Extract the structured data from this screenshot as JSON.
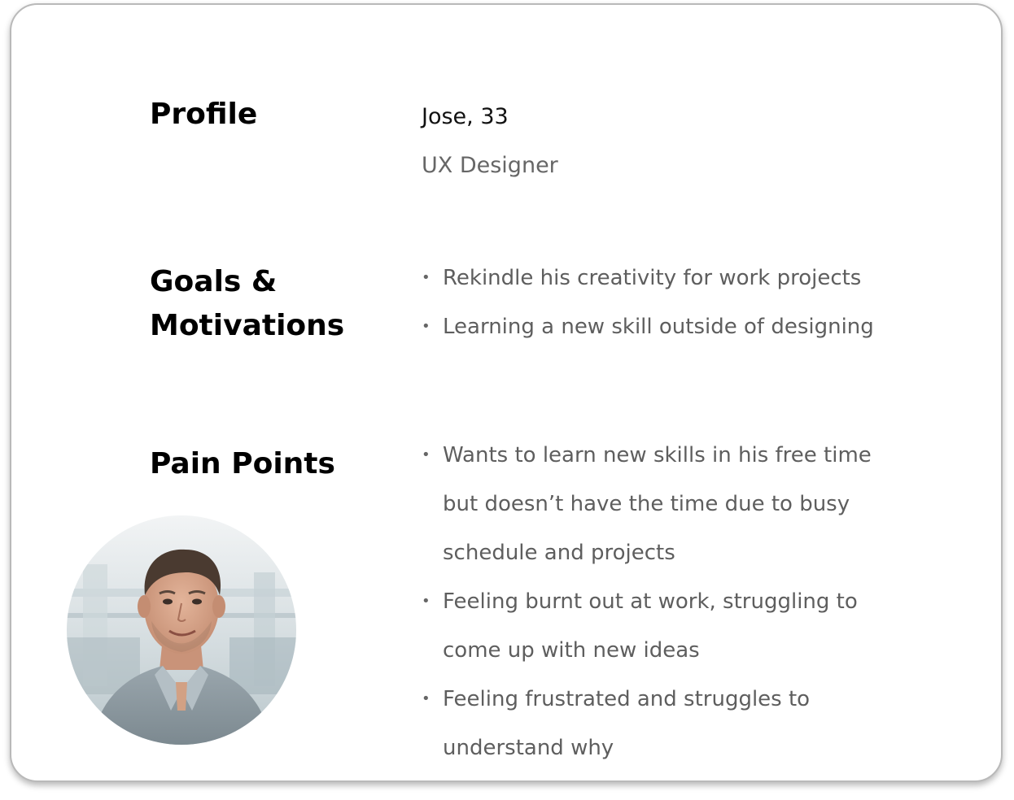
{
  "profile": {
    "heading": "Profile",
    "name_age": "Jose, 33",
    "role": "UX Designer"
  },
  "goals": {
    "heading_line1": "Goals &",
    "heading_line2": "Motivations",
    "items": [
      "Rekindle his creativity for work projects",
      "Learning a new skill outside of designing"
    ]
  },
  "pain_points": {
    "heading": "Pain Points",
    "lines": [
      "Wants to learn new skills in his free time",
      "but doesn’t have the time due to busy",
      "schedule and projects",
      "Feeling burnt out at work, struggling to",
      "come up with new ideas",
      "Feeling frustrated and struggles to",
      "understand why"
    ]
  },
  "colors": {
    "heading": "#000000",
    "body_text": "#5e5e5e",
    "card_border": "#b9b9b9"
  },
  "avatar": {
    "icon": "person-photo"
  }
}
